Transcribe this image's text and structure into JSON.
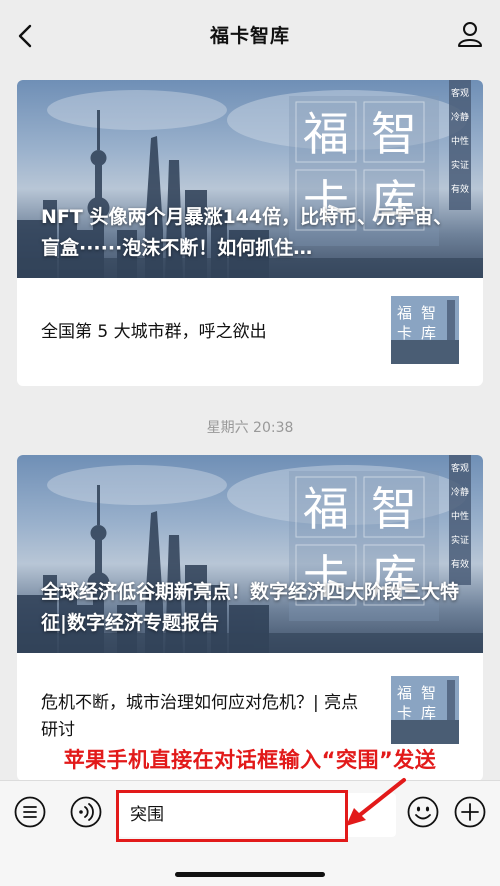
{
  "header": {
    "title": "福卡智库",
    "back_icon": "chevron-left-icon",
    "profile_icon": "person-icon"
  },
  "cover_art": {
    "brand_chars": [
      "福",
      "智",
      "卡",
      "库"
    ],
    "vertical_tags": [
      "客观",
      "冷静",
      "中性",
      "实证",
      "有效"
    ]
  },
  "messages": [
    {
      "headline": "NFT 头像两个月暴涨144倍，比特币、元宇宙、盲盒······泡沫不断！如何抓住…",
      "sub_article": "全国第 5 大城市群，呼之欲出"
    },
    {
      "headline": "全球经济低谷期新亮点！数字经济四大阶段三大特征|数字经济专题报告",
      "sub_article": "危机不断，城市治理如何应对危机？| 亮点研讨"
    }
  ],
  "timestamp": "星期六 20:38",
  "instruction": "苹果手机直接在对话框输入“突围”发送",
  "input_bar": {
    "text_value": "突围",
    "icons": [
      "menu-list-icon",
      "voice-icon",
      "emoji-icon",
      "plus-icon"
    ]
  },
  "colors": {
    "background": "#ededed",
    "annotation_red": "#e21a1a",
    "timestamp_gray": "#999999"
  }
}
